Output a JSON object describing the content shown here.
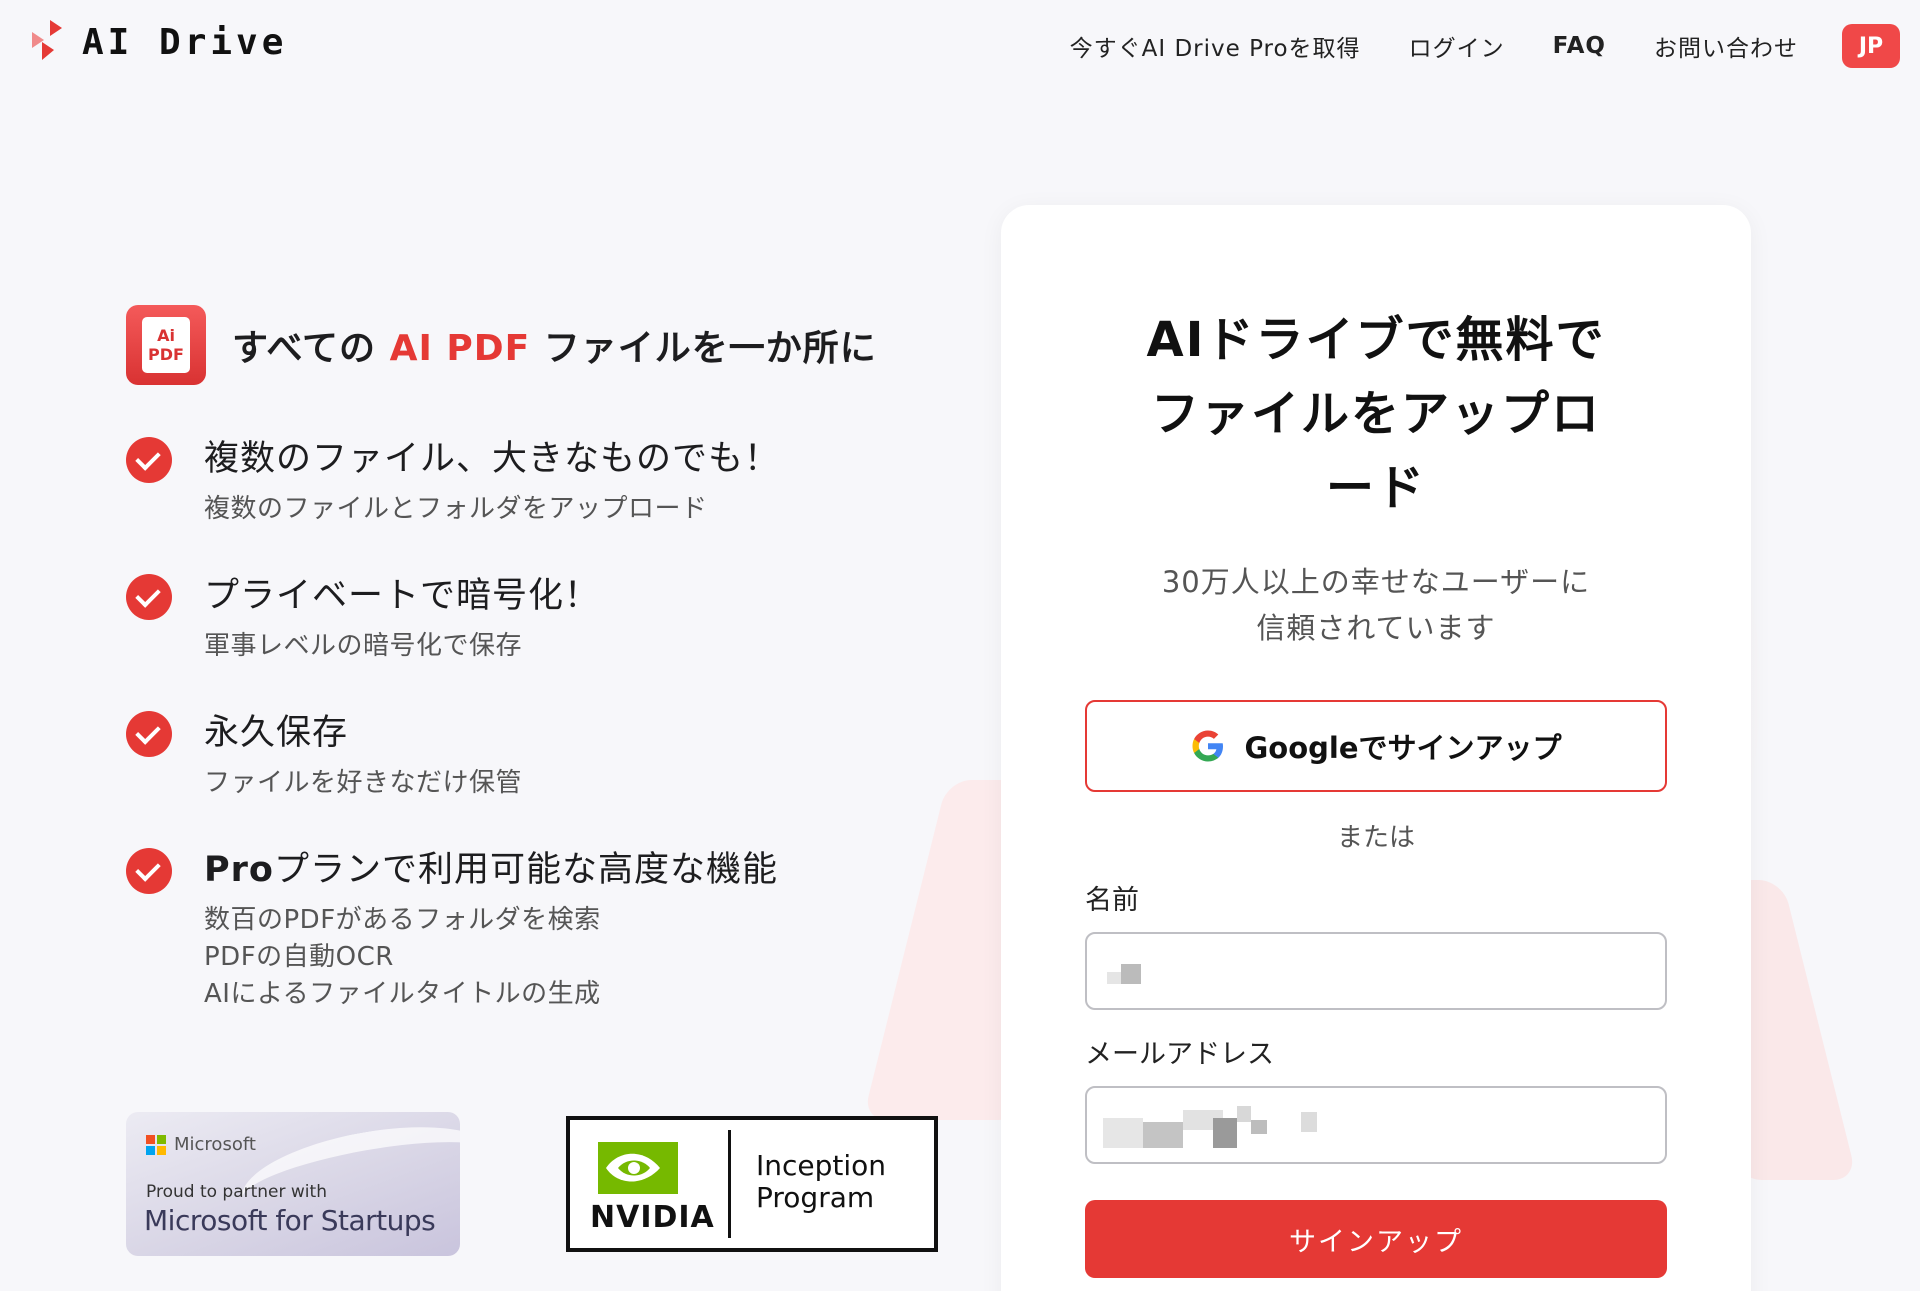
{
  "header": {
    "logo_text": "AI Drive",
    "nav": {
      "get_pro": "今すぐAI Drive Proを取得",
      "login": "ログイン",
      "faq": "FAQ",
      "contact": "お問い合わせ",
      "language": "JP"
    }
  },
  "hero": {
    "icon_line1": "Ai",
    "icon_line2": "PDF",
    "title_prefix": "すべての",
    "title_accent": "AI PDF",
    "title_suffix": "ファイルを一か所に"
  },
  "features": [
    {
      "title": "複数のファイル、大きなものでも！",
      "sub": "複数のファイルとフォルダをアップロード"
    },
    {
      "title": "プライベートで暗号化！",
      "sub": "軍事レベルの暗号化で保存"
    },
    {
      "title": "永久保存",
      "sub": "ファイルを好きなだけ保管"
    },
    {
      "title_bold": "Pro",
      "title": "プランで利用可能な高度な機能",
      "sub_lines": [
        "数百のPDFがあるフォルダを検索",
        "PDFの自動OCR",
        "AIによるファイルタイトルの生成"
      ]
    }
  ],
  "badges": {
    "microsoft": {
      "brand": "Microsoft",
      "proud": "Proud to partner with",
      "program": "Microsoft for Startups"
    },
    "nvidia": {
      "brand": "NVIDIA",
      "program_line1": "Inception",
      "program_line2": "Program"
    }
  },
  "signup": {
    "title_line1": "AIドライブで無料で",
    "title_line2": "ファイルをアップロ",
    "title_line3": "ード",
    "subtitle_line1": "30万人以上の幸せなユーザーに",
    "subtitle_line2": "信頼されています",
    "google_button": "Googleでサインアップ",
    "or": "または",
    "name_label": "名前",
    "email_label": "メールアドレス",
    "submit": "サインアップ"
  },
  "colors": {
    "accent": "#e53935",
    "background": "#f7f7fa",
    "card": "#ffffff"
  }
}
